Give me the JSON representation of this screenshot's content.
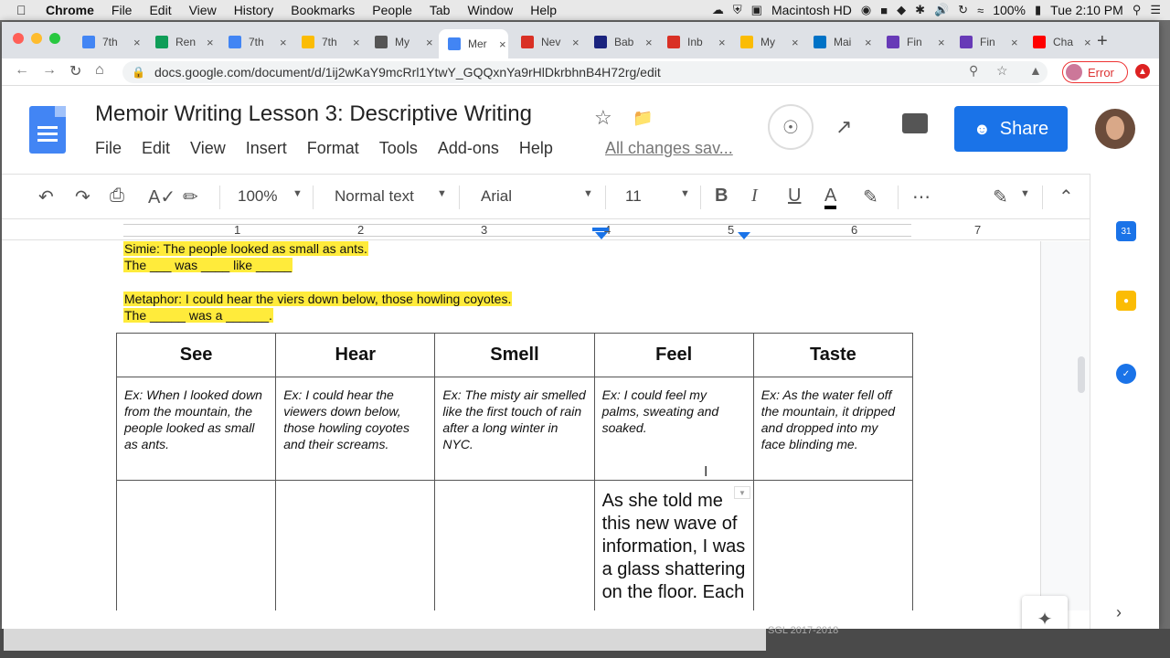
{
  "menubar": {
    "app": "Chrome",
    "items": [
      "File",
      "Edit",
      "View",
      "History",
      "Bookmarks",
      "People",
      "Tab",
      "Window",
      "Help"
    ],
    "disk": "Macintosh HD",
    "battery": "100%",
    "clock": "Tue 2:10 PM"
  },
  "tabs": [
    {
      "label": "7th",
      "color": "#4285f4",
      "icon": "docs-icon"
    },
    {
      "label": "Ren",
      "color": "#0f9d58",
      "icon": "sheets-icon"
    },
    {
      "label": "7th",
      "color": "#4285f4",
      "icon": "docs-icon"
    },
    {
      "label": "7th",
      "color": "#fbbc04",
      "icon": "drive-icon"
    },
    {
      "label": "My",
      "color": "#555555",
      "icon": "web-icon"
    },
    {
      "label": "Mer",
      "color": "#4285f4",
      "icon": "docs-icon"
    },
    {
      "label": "Nev",
      "color": "#d93025",
      "icon": "gmail-icon"
    },
    {
      "label": "Bab",
      "color": "#1a237e",
      "icon": "site-icon"
    },
    {
      "label": "Inb",
      "color": "#d93025",
      "icon": "gmail-icon"
    },
    {
      "label": "My",
      "color": "#fbbc04",
      "icon": "drive-icon"
    },
    {
      "label": "Mai",
      "color": "#0072c6",
      "icon": "outlook-icon"
    },
    {
      "label": "Fin",
      "color": "#673ab7",
      "icon": "forms-icon"
    },
    {
      "label": "Fin",
      "color": "#673ab7",
      "icon": "forms-icon"
    },
    {
      "label": "Cha",
      "color": "#ff0000",
      "icon": "youtube-icon"
    }
  ],
  "omnibox": {
    "url": "docs.google.com/document/d/1ij2wKaY9mcRrl1YtwY_GQQxnYa9rHlDkrbhnB4H72rg/edit",
    "error_label": "Error"
  },
  "doc": {
    "title": "Memoir Writing Lesson 3: Descriptive Writing",
    "menus": [
      "File",
      "Edit",
      "View",
      "Insert",
      "Format",
      "Tools",
      "Add-ons",
      "Help"
    ],
    "saved_status": "All changes sav...",
    "share_label": "Share"
  },
  "toolbar": {
    "zoom": "100%",
    "style": "Normal text",
    "font": "Arial",
    "size": "11",
    "bold": "B",
    "italic": "I",
    "underline": "U",
    "text_color": "A"
  },
  "ruler": [
    "1",
    "2",
    "3",
    "4",
    "5",
    "6",
    "7"
  ],
  "body": {
    "simile_line1": "Simie: The people looked as small as ants.",
    "simile_line2": "The ___ was ____ like _____",
    "metaphor_line1": "Metaphor: I could hear the viers down below, those howling coyotes.",
    "metaphor_line2": "The _____ was a ______."
  },
  "table": {
    "headers": [
      "See",
      "Hear",
      "Smell",
      "Feel",
      "Taste"
    ],
    "examples": [
      "Ex: When I looked down from the mountain, the people looked as small as ants.",
      "Ex: I could hear the viewers down below, those howling coyotes and their screams.",
      "Ex: The misty air smelled like the first touch of rain after a long winter in NYC.",
      "Ex: I could feel my palms, sweating and soaked.",
      "Ex: As the water fell off the mountain, it dripped and dropped into my face blinding me."
    ],
    "feel_entry": "As she told me this new wave of information, I was a glass shattering on the floor. Each"
  },
  "sidepanel": {
    "calendar_label": "31"
  },
  "footer": {
    "text": "SGL 2017-2018"
  }
}
